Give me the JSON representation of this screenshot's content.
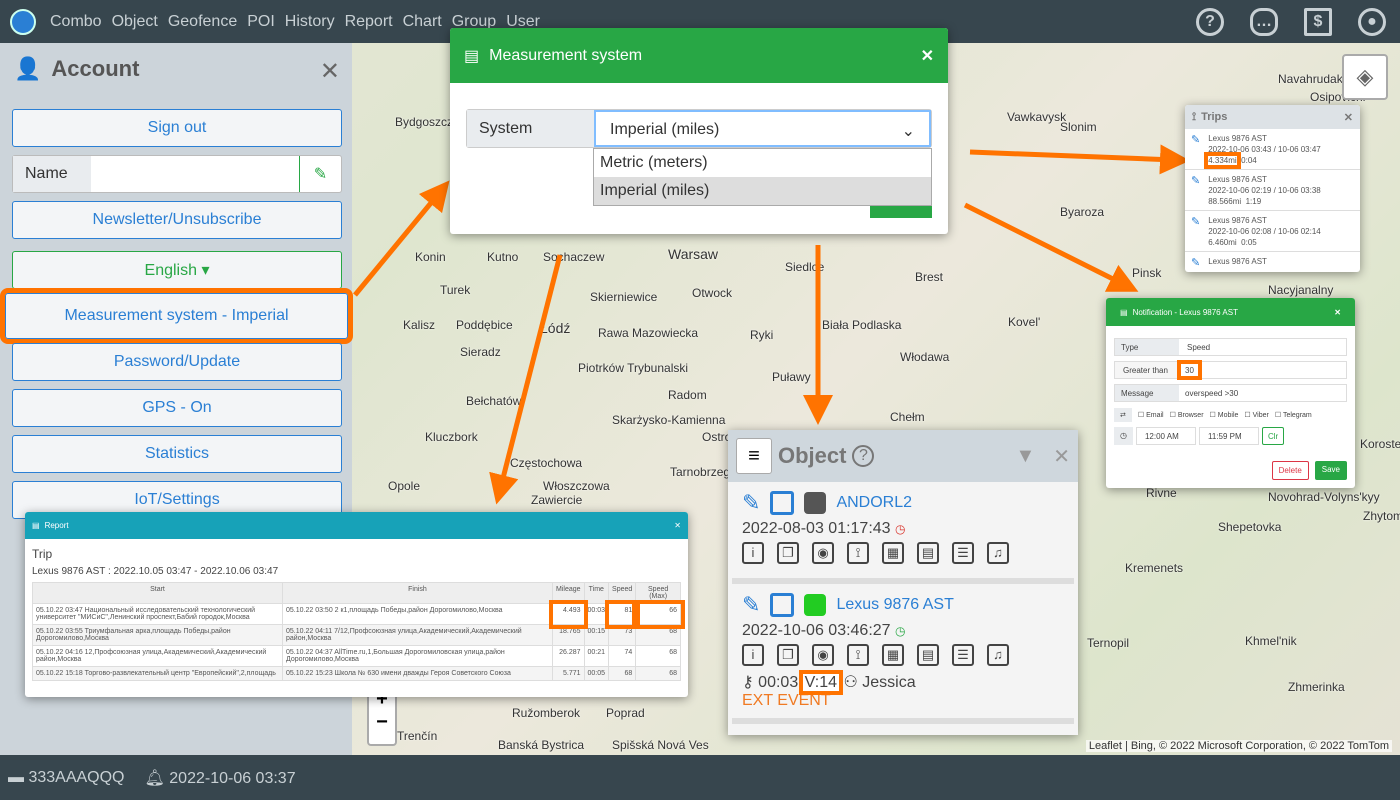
{
  "nav": {
    "items": [
      "Combo",
      "Object",
      "Geofence",
      "POI",
      "History",
      "Report",
      "Chart",
      "Group",
      "User"
    ],
    "icons": [
      "help-icon",
      "chat-icon",
      "invoice-icon",
      "user-icon"
    ]
  },
  "map": {
    "labels": [
      "Bydgoszcz",
      "Navahrudak",
      "Vawkavysk",
      "Slonim",
      "Osipovichi",
      "Byaroza",
      "Konin",
      "Kutno",
      "Sochaczew",
      "Warsaw",
      "Siedlce",
      "Brest",
      "Pinsk",
      "Turek",
      "Skierniewice",
      "Otwock",
      "Kalisz",
      "Poddębice",
      "Łódź",
      "Rawa Mazowiecka",
      "Ryki",
      "Biała Podlaska",
      "Sieradz",
      "Piotrków Trybunalski",
      "Puławy",
      "Włodawa",
      "Kovel'",
      "Bełchatów",
      "Radom",
      "Skarżysko-Kamienna",
      "Chełm",
      "Kluczbork",
      "Częstochowa",
      "Opole",
      "Włoszczowa",
      "Zawiercie",
      "Ostrowiec",
      "Tarnobrzeg",
      "Rivne",
      "Novohrad-Volyns'kyy",
      "Zhytomyr",
      "Korosten",
      "Shepetovka",
      "Kremenets",
      "Ternopil",
      "Khmel'nik",
      "Zhmerinka",
      "Ružomberok",
      "Poprad",
      "Banská Bystrica",
      "Spišská Nová Ves",
      "Trenčín",
      "Nacyjanalny"
    ],
    "attribution": "Leaflet | Bing, © 2022 Microsoft Corporation, © 2022 TomTom",
    "zoom_in": "+",
    "zoom_out": "−"
  },
  "sidebar": {
    "title": "Account",
    "sign_out": "Sign out",
    "name_label": "Name",
    "name_value": "",
    "newsletter": "Newsletter/Unsubscribe",
    "language": "English ▾",
    "measurement": "Measurement system - Imperial",
    "password": "Password/Update",
    "gps": "GPS - On",
    "statistics": "Statistics",
    "iot": "IoT/Settings"
  },
  "status": {
    "folder": "333AAAQQQ",
    "event_time": "2022-10-06 03:37"
  },
  "measurement_modal": {
    "title": "Measurement system",
    "label": "System",
    "selected": "Imperial (miles)",
    "options": [
      "Metric (meters)",
      "Imperial (miles)"
    ]
  },
  "trips": {
    "title": "Trips",
    "items": [
      {
        "name": "Lexus 9876 AST",
        "period": "2022-10-06 03:43 / 10-06 03:47",
        "distance": "4.334mi",
        "duration": "0:04"
      },
      {
        "name": "Lexus 9876 AST",
        "period": "2022-10-06 02:19 / 10-06 03:38",
        "distance": "88.566mi",
        "duration": "1:19"
      },
      {
        "name": "Lexus 9876 AST",
        "period": "2022-10-06 02:08 / 10-06 02:14",
        "distance": "6.460mi",
        "duration": "0:05"
      },
      {
        "name": "Lexus 9876 AST",
        "period": "",
        "distance": "",
        "duration": ""
      }
    ]
  },
  "notification": {
    "title": "Notification - Lexus 9876 AST",
    "type_label": "Type",
    "type_value": "Speed",
    "greater_label": "Greater than",
    "greater_value": "30",
    "message_label": "Message",
    "message_value": "overspeed >30",
    "channels": [
      "Email",
      "Browser",
      "Mobile",
      "Viber",
      "Telegram"
    ],
    "time_from": "12:00 AM",
    "time_to": "11:59 PM",
    "clear": "Clr",
    "delete": "Delete",
    "save": "Save"
  },
  "report": {
    "title": "Report",
    "heading": "Trip",
    "subtitle": "Lexus 9876 AST : 2022.10.05 03:47 - 2022.10.06 03:47",
    "columns": [
      "Start",
      "Finish",
      "Mileage",
      "Time",
      "Speed",
      "Speed (Max)"
    ],
    "rows": [
      [
        "05.10.22 03:47 Национальный исследовательский технологический университет \"МИСиС\",Ленинский проспект,Бабий городок,Москва",
        "05.10.22 03:50 2 к1,площадь Победы,район Дорогомилово,Москва",
        "4.493",
        "00:03",
        "81",
        "66"
      ],
      [
        "05.10.22 03:55 Триумфальная арка,площадь Победы,район Дорогомилово,Москва",
        "05.10.22 04:11 7/12,Профсоюзная улица,Академический,Академический район,Москва",
        "18.765",
        "00:15",
        "73",
        "68"
      ],
      [
        "05.10.22 04:16 12,Профсоюзная улица,Академический,Академический район,Москва",
        "05.10.22 04:37 AllTime.ru,1,Большая Дорогомиловская улица,район Дорогомилово,Москва",
        "26.287",
        "00:21",
        "74",
        "68"
      ],
      [
        "05.10.22 15:18 Торгово-развлекательный центр \"Европейский\",2,площадь",
        "05.10.22 15:23 Школа № 630 имени дважды Героя Советского Союза",
        "5.771",
        "00:05",
        "68",
        "68"
      ]
    ]
  },
  "object_panel": {
    "title": "Object",
    "objects": [
      {
        "name": "ANDORL2",
        "time": "2022-08-03 01:17:43",
        "status_color": "#d9342b"
      },
      {
        "name": "Lexus 9876 AST",
        "time": "2022-10-06 03:46:27",
        "status_color": "#28a745",
        "duration": "00:03",
        "speed": "V:14",
        "driver": "Jessica",
        "event": "EXT EVENT"
      }
    ]
  },
  "colors": {
    "accent": "#ff7300",
    "green": "#28a745",
    "blue": "#2a7fd4",
    "teal": "#17a2b8"
  }
}
